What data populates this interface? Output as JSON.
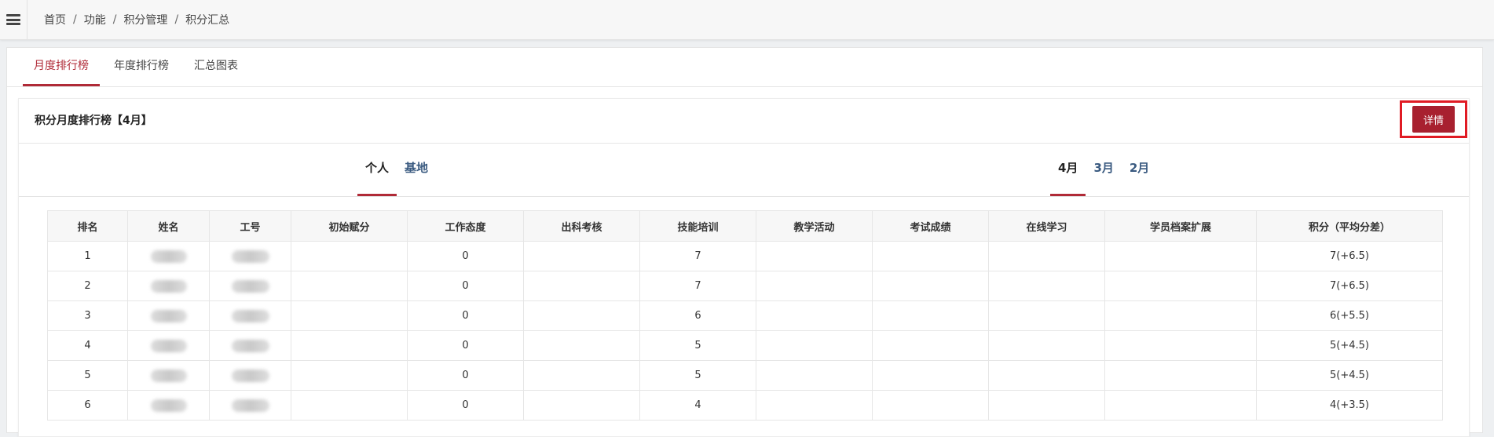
{
  "breadcrumb": [
    "首页",
    "功能",
    "积分管理",
    "积分汇总"
  ],
  "tabs": [
    {
      "label": "月度排行榜",
      "active": true
    },
    {
      "label": "年度排行榜",
      "active": false
    },
    {
      "label": "汇总图表",
      "active": false
    }
  ],
  "card": {
    "title": "积分月度排行榜【4月】",
    "detail_button": "详情"
  },
  "scope_tabs": [
    {
      "label": "个人",
      "active": true
    },
    {
      "label": "基地",
      "active": false
    }
  ],
  "month_tabs": [
    {
      "label": "4月",
      "active": true
    },
    {
      "label": "3月",
      "active": false
    },
    {
      "label": "2月",
      "active": false
    }
  ],
  "table": {
    "headers": [
      "排名",
      "姓名",
      "工号",
      "初始赋分",
      "工作态度",
      "出科考核",
      "技能培训",
      "教学活动",
      "考试成绩",
      "在线学习",
      "学员档案扩展",
      "积分（平均分差）"
    ],
    "rows": [
      [
        "1",
        "",
        "",
        "",
        "0",
        "",
        "7",
        "",
        "",
        "",
        "",
        "7(+6.5)"
      ],
      [
        "2",
        "",
        "",
        "",
        "0",
        "",
        "7",
        "",
        "",
        "",
        "",
        "7(+6.5)"
      ],
      [
        "3",
        "",
        "",
        "",
        "0",
        "",
        "6",
        "",
        "",
        "",
        "",
        "6(+5.5)"
      ],
      [
        "4",
        "",
        "",
        "",
        "0",
        "",
        "5",
        "",
        "",
        "",
        "",
        "5(+4.5)"
      ],
      [
        "5",
        "",
        "",
        "",
        "0",
        "",
        "5",
        "",
        "",
        "",
        "",
        "5(+4.5)"
      ],
      [
        "6",
        "",
        "",
        "",
        "0",
        "",
        "4",
        "",
        "",
        "",
        "",
        "4(+3.5)"
      ]
    ]
  },
  "colors": {
    "accent": "#b02a37",
    "highlight_border": "#e01b24",
    "link": "#3a5a80"
  },
  "icons": {
    "menu": "hamburger-icon"
  }
}
